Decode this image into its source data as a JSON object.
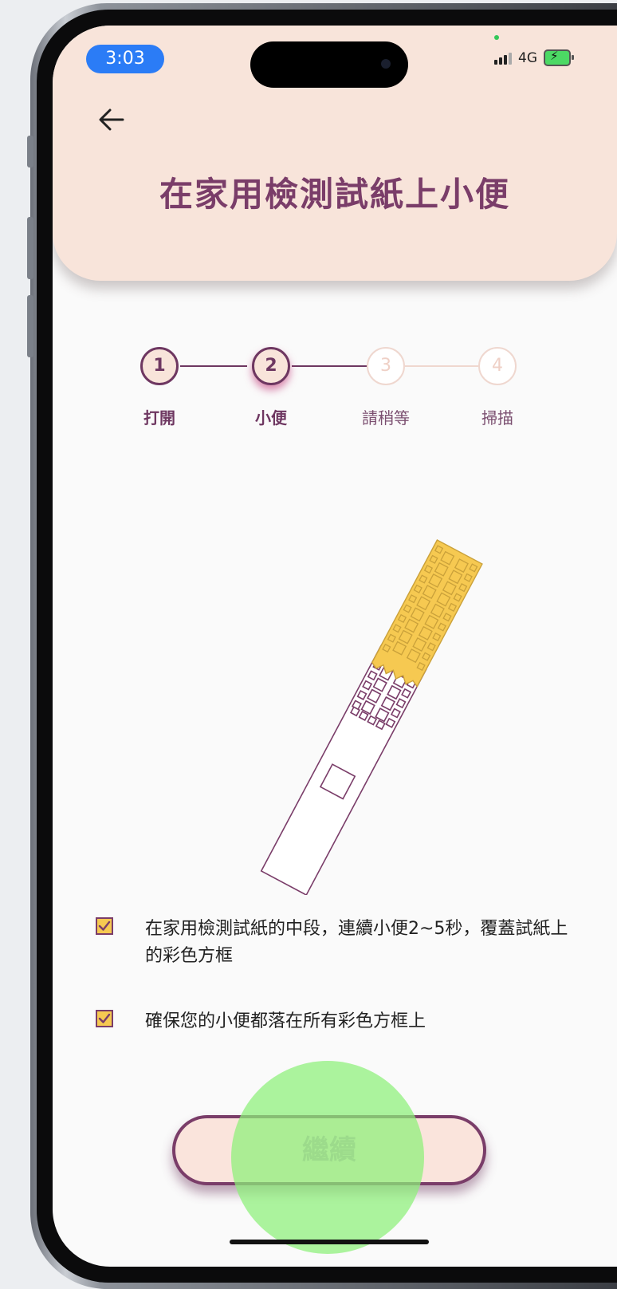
{
  "status_bar": {
    "time": "3:03",
    "network": "4G"
  },
  "header": {
    "title": "在家用檢測試紙上小便"
  },
  "steps": [
    {
      "number": "1",
      "label": "打開"
    },
    {
      "number": "2",
      "label": "小便"
    },
    {
      "number": "3",
      "label": "請稍等"
    },
    {
      "number": "4",
      "label": "掃描"
    }
  ],
  "current_step": 2,
  "instructions": [
    {
      "text": "在家用檢測試紙的中段，連續小便2~5秒，覆蓋試紙上的彩色方框",
      "checked": true
    },
    {
      "text": "確保您的小便都落在所有彩色方框上",
      "checked": true
    }
  ],
  "continue_button": {
    "label": "繼續"
  },
  "colors": {
    "brand": "#7a3d69",
    "header_bg": "#f8e4da",
    "strip_fill": "#f6c951",
    "checkbox_fill": "#f6c951",
    "tap_indicator": "#8cf078"
  }
}
